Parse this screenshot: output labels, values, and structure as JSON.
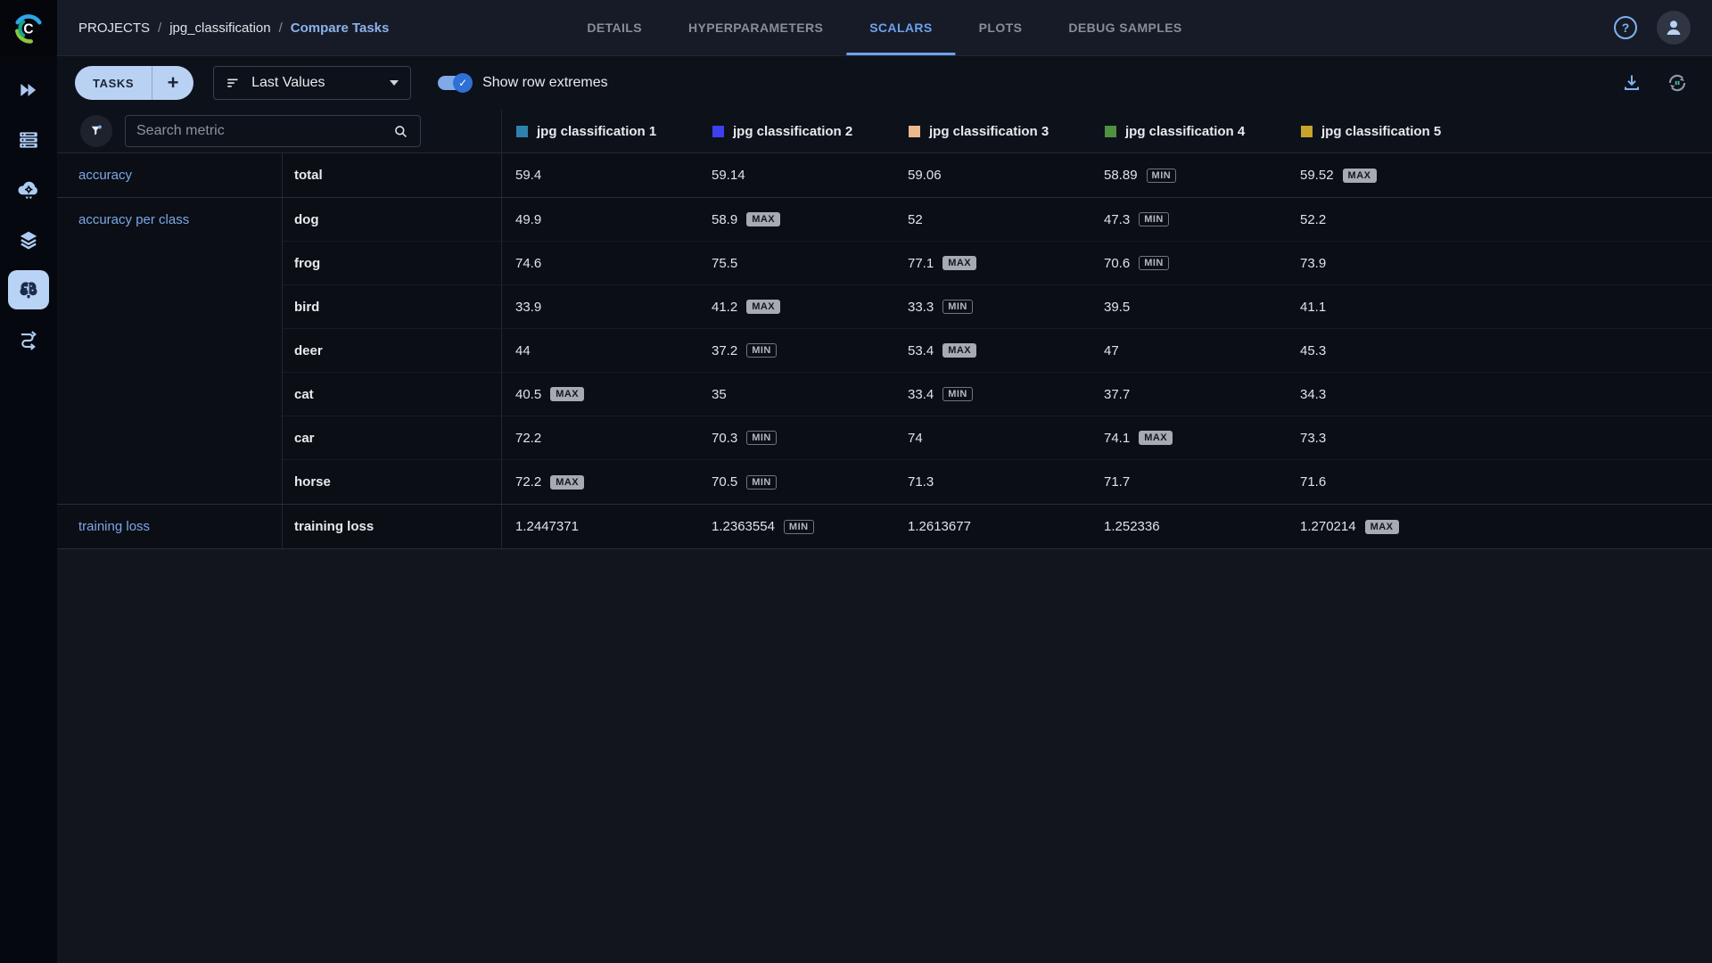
{
  "header": {
    "breadcrumb": {
      "items": [
        "PROJECTS",
        "jpg_classification",
        "Compare Tasks"
      ],
      "separator": "/"
    },
    "tabs": [
      {
        "label": "DETAILS",
        "active": false
      },
      {
        "label": "HYPERPARAMETERS",
        "active": false
      },
      {
        "label": "SCALARS",
        "active": true
      },
      {
        "label": "PLOTS",
        "active": false
      },
      {
        "label": "DEBUG SAMPLES",
        "active": false
      }
    ],
    "help_label": "?"
  },
  "sidebar": {
    "logo_letter": "C",
    "icons": [
      {
        "name": "play-arrows-icon",
        "active": false
      },
      {
        "name": "server-rack-icon",
        "active": false
      },
      {
        "name": "cloud-gear-icon",
        "active": false
      },
      {
        "name": "layers-icon",
        "active": false
      },
      {
        "name": "brain-icon",
        "active": true
      },
      {
        "name": "pipeline-icon",
        "active": false
      }
    ]
  },
  "toolbar": {
    "tasks_button": {
      "label": "TASKS",
      "plus": "+"
    },
    "values_dropdown": {
      "value": "Last Values"
    },
    "extremes_toggle": {
      "label": "Show row extremes",
      "on": true,
      "check": "✓"
    }
  },
  "metric_table": {
    "search_placeholder": "Search metric",
    "experiments": [
      {
        "name": "jpg classification 1",
        "color": "#2e81ad"
      },
      {
        "name": "jpg classification 2",
        "color": "#3e3ff0"
      },
      {
        "name": "jpg classification 3",
        "color": "#eab98f"
      },
      {
        "name": "jpg classification 4",
        "color": "#4f9140"
      },
      {
        "name": "jpg classification 5",
        "color": "#c8a42d"
      }
    ],
    "badges": {
      "min": "MIN",
      "max": "MAX"
    },
    "groups": [
      {
        "metric": "accuracy",
        "rows": [
          {
            "variant": "total",
            "values": [
              {
                "v": "59.4"
              },
              {
                "v": "59.14"
              },
              {
                "v": "59.06"
              },
              {
                "v": "58.89",
                "badge": "MIN"
              },
              {
                "v": "59.52",
                "badge": "MAX"
              }
            ]
          }
        ]
      },
      {
        "metric": "accuracy per class",
        "rows": [
          {
            "variant": "dog",
            "values": [
              {
                "v": "49.9"
              },
              {
                "v": "58.9",
                "badge": "MAX"
              },
              {
                "v": "52"
              },
              {
                "v": "47.3",
                "badge": "MIN"
              },
              {
                "v": "52.2"
              }
            ]
          },
          {
            "variant": "frog",
            "values": [
              {
                "v": "74.6"
              },
              {
                "v": "75.5"
              },
              {
                "v": "77.1",
                "badge": "MAX"
              },
              {
                "v": "70.6",
                "badge": "MIN"
              },
              {
                "v": "73.9"
              }
            ]
          },
          {
            "variant": "bird",
            "values": [
              {
                "v": "33.9"
              },
              {
                "v": "41.2",
                "badge": "MAX"
              },
              {
                "v": "33.3",
                "badge": "MIN"
              },
              {
                "v": "39.5"
              },
              {
                "v": "41.1"
              }
            ]
          },
          {
            "variant": "deer",
            "values": [
              {
                "v": "44"
              },
              {
                "v": "37.2",
                "badge": "MIN"
              },
              {
                "v": "53.4",
                "badge": "MAX"
              },
              {
                "v": "47"
              },
              {
                "v": "45.3"
              }
            ]
          },
          {
            "variant": "cat",
            "values": [
              {
                "v": "40.5",
                "badge": "MAX"
              },
              {
                "v": "35"
              },
              {
                "v": "33.4",
                "badge": "MIN"
              },
              {
                "v": "37.7"
              },
              {
                "v": "34.3"
              }
            ]
          },
          {
            "variant": "car",
            "values": [
              {
                "v": "72.2"
              },
              {
                "v": "70.3",
                "badge": "MIN"
              },
              {
                "v": "74"
              },
              {
                "v": "74.1",
                "badge": "MAX"
              },
              {
                "v": "73.3"
              }
            ]
          },
          {
            "variant": "horse",
            "values": [
              {
                "v": "72.2",
                "badge": "MAX"
              },
              {
                "v": "70.5",
                "badge": "MIN"
              },
              {
                "v": "71.3"
              },
              {
                "v": "71.7"
              },
              {
                "v": "71.6"
              }
            ]
          }
        ]
      },
      {
        "metric": "training loss",
        "rows": [
          {
            "variant": "training loss",
            "values": [
              {
                "v": "1.2447371"
              },
              {
                "v": "1.2363554",
                "badge": "MIN"
              },
              {
                "v": "1.2613677"
              },
              {
                "v": "1.252336"
              },
              {
                "v": "1.270214",
                "badge": "MAX"
              }
            ]
          }
        ]
      }
    ]
  },
  "colors": {
    "accent_blue": "#6fa1ec",
    "link_blue": "#7ca7e6",
    "button_blue": "#b9d2f4",
    "badge_max_bg": "#a5aab3",
    "row_bg": "#0b0e15",
    "topbar_bg": "#161b27"
  }
}
